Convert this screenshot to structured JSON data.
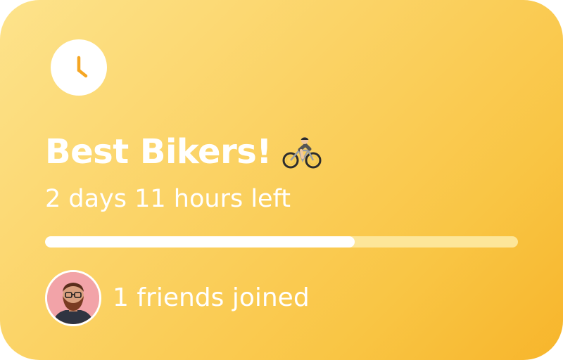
{
  "card": {
    "title": "Best Bikers!",
    "title_emoji": "person-biking-emoji",
    "time_left": "2 days 11 hours left",
    "progress_fraction": 0.655,
    "friends_text": "1 friends joined",
    "clock_icon": "clock-icon",
    "avatar": "friend-avatar"
  },
  "colors": {
    "gradient_start": "#fde38c",
    "gradient_end": "#f7b52b",
    "clock_hand": "#f5a623",
    "progress_fill": "#ffffff",
    "progress_track": "#fde699",
    "text": "#ffffff"
  }
}
